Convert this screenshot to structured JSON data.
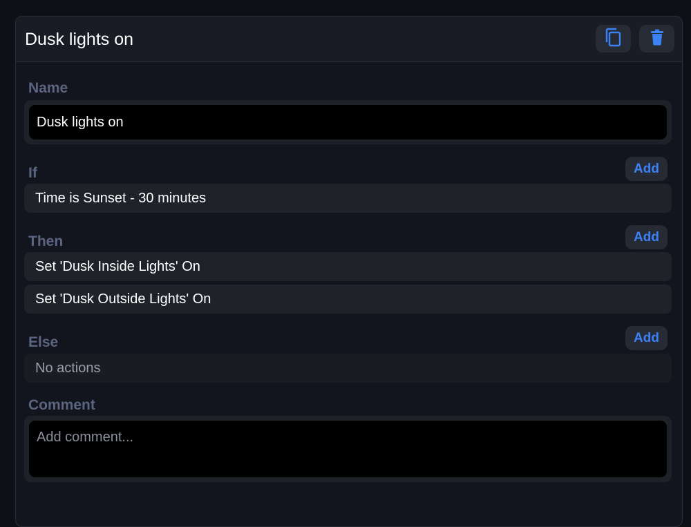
{
  "automation": {
    "title": "Dusk lights on",
    "toolbar": {
      "copy_icon": "copy-icon",
      "delete_icon": "trash-icon",
      "accent_color": "#3c82f6"
    },
    "name": {
      "label": "Name",
      "value": "Dusk lights on"
    },
    "if": {
      "label": "If",
      "add_label": "Add",
      "conditions": [
        "Time is Sunset - 30 minutes"
      ]
    },
    "then": {
      "label": "Then",
      "add_label": "Add",
      "actions": [
        "Set 'Dusk Inside Lights' On",
        "Set 'Dusk Outside Lights' On"
      ]
    },
    "else": {
      "label": "Else",
      "add_label": "Add",
      "empty_text": "No actions"
    },
    "comment": {
      "label": "Comment",
      "placeholder": "Add comment...",
      "value": ""
    }
  }
}
